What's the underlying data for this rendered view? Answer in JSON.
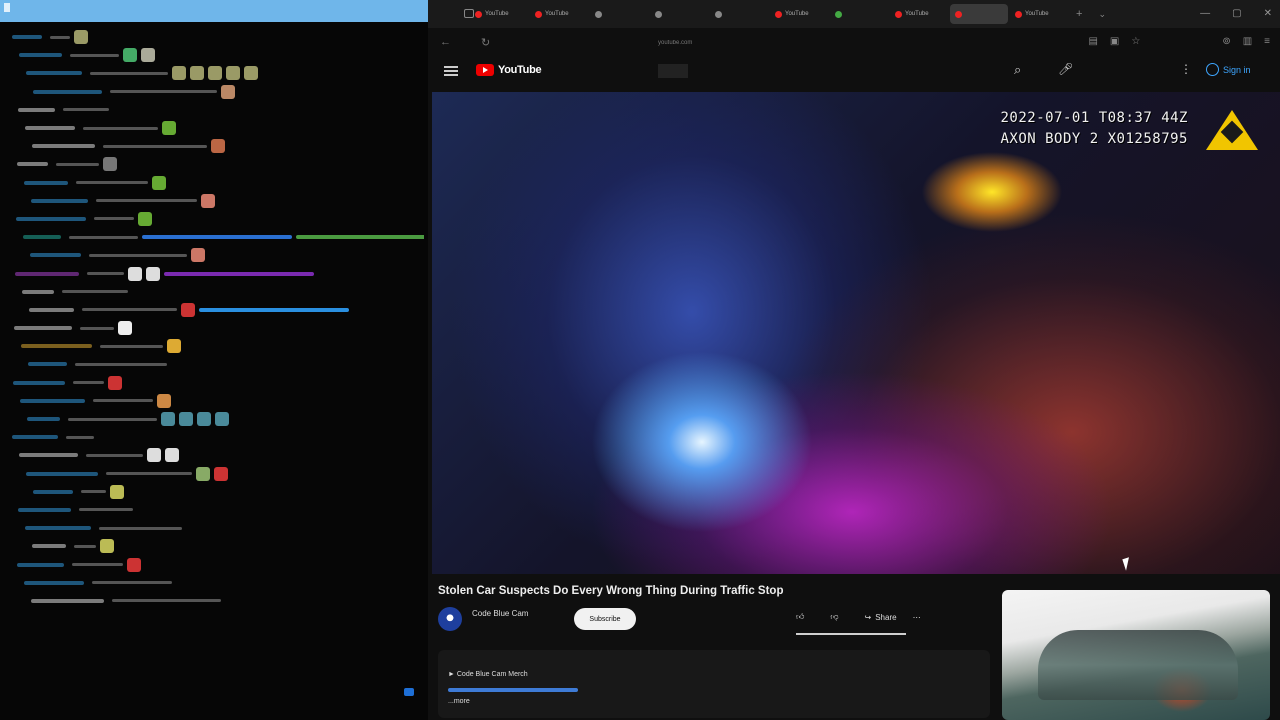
{
  "chat": {
    "rows": [
      {
        "user": "",
        "msg": "",
        "uc": "#39d",
        "emotes": [
          "#9a9a66"
        ],
        "bars": []
      },
      {
        "user": "",
        "msg": "",
        "uc": "#39d",
        "emotes": [
          "#4a6",
          "#aa9"
        ],
        "bars": []
      },
      {
        "user": "",
        "msg": "",
        "uc": "#39d",
        "emotes": [
          "#9a9a66",
          "#9a9a66",
          "#9a9a66",
          "#9a9a66",
          "#9a9a66"
        ],
        "bars": []
      },
      {
        "user": "",
        "msg": "",
        "uc": "#39d",
        "emotes": [
          "#b86"
        ],
        "bars": []
      },
      {
        "user": "",
        "msg": "",
        "uc": "#ddd",
        "emotes": [],
        "bars": []
      },
      {
        "user": "",
        "msg": "",
        "uc": "#ddd",
        "emotes": [
          "#6a3"
        ],
        "bars": []
      },
      {
        "user": "",
        "msg": "",
        "uc": "#ddd",
        "emotes": [
          "#b64"
        ],
        "bars": []
      },
      {
        "user": "",
        "msg": "",
        "uc": "#ddd",
        "emotes": [
          "#777"
        ],
        "bars": []
      },
      {
        "user": "",
        "msg": "",
        "uc": "#39d",
        "emotes": [
          "#6a3"
        ],
        "bars": []
      },
      {
        "user": "",
        "msg": "",
        "uc": "#39d",
        "emotes": [
          "#c76"
        ],
        "bars": []
      },
      {
        "user": "",
        "msg": "",
        "uc": "#39d",
        "emotes": [
          "#6a3"
        ],
        "bars": []
      },
      {
        "user": "",
        "msg": "",
        "uc": "#2a9",
        "emotes": [],
        "bars": [
          "#2a6fd0",
          "#4a9a40"
        ]
      },
      {
        "user": "",
        "msg": "",
        "uc": "#39d",
        "emotes": [
          "#c76"
        ],
        "bars": []
      },
      {
        "user": "",
        "msg": "",
        "uc": "#a4c",
        "emotes": [
          "#ddd",
          "#ddd"
        ],
        "bars": [
          "#7a2ab0"
        ]
      },
      {
        "user": "",
        "msg": "",
        "uc": "#ddd",
        "emotes": [],
        "bars": []
      },
      {
        "user": "",
        "msg": "",
        "uc": "#ddd",
        "emotes": [
          "#c33"
        ],
        "bars": [
          "#2a8fe0"
        ]
      },
      {
        "user": "",
        "msg": "",
        "uc": "#ddd",
        "emotes": [
          "#eee"
        ],
        "bars": []
      },
      {
        "user": "",
        "msg": "",
        "uc": "#da3",
        "emotes": [
          "#da3"
        ],
        "bars": []
      },
      {
        "user": "",
        "msg": "",
        "uc": "#39d",
        "emotes": [],
        "bars": []
      },
      {
        "user": "",
        "msg": "",
        "uc": "#39d",
        "emotes": [
          "#c33"
        ],
        "bars": []
      },
      {
        "user": "",
        "msg": "",
        "uc": "#39d",
        "emotes": [
          "#c84"
        ],
        "bars": []
      },
      {
        "user": "",
        "msg": "",
        "uc": "#39d",
        "emotes": [
          "#4a8a9a",
          "#4a8a9a",
          "#4a8a9a",
          "#4a8a9a"
        ],
        "bars": []
      },
      {
        "user": "",
        "msg": "",
        "uc": "#39d",
        "emotes": [],
        "bars": []
      },
      {
        "user": "",
        "msg": "",
        "uc": "#ddd",
        "emotes": [
          "#ddd",
          "#ddd"
        ],
        "bars": []
      },
      {
        "user": "",
        "msg": "",
        "uc": "#39d",
        "emotes": [
          "#8a6",
          "#c33"
        ],
        "bars": []
      },
      {
        "user": "",
        "msg": "",
        "uc": "#39d",
        "emotes": [
          "#bb5"
        ],
        "bars": []
      },
      {
        "user": "",
        "msg": "",
        "uc": "#39d",
        "emotes": [],
        "bars": []
      },
      {
        "user": "",
        "msg": "",
        "uc": "#39d",
        "emotes": [],
        "bars": []
      },
      {
        "user": "",
        "msg": "",
        "uc": "#ddd",
        "emotes": [
          "#bb5"
        ],
        "bars": []
      },
      {
        "user": "",
        "msg": "",
        "uc": "#39d",
        "emotes": [
          "#c33"
        ],
        "bars": []
      },
      {
        "user": "",
        "msg": "",
        "uc": "#39d",
        "emotes": [],
        "bars": []
      },
      {
        "user": "",
        "msg": "",
        "uc": "#ddd",
        "emotes": [],
        "bars": []
      }
    ]
  },
  "browser": {
    "tabs": [
      {
        "label": "YouTube",
        "color": "#e22",
        "active": false
      },
      {
        "label": "YouTube",
        "color": "#e22",
        "active": false
      },
      {
        "label": "",
        "color": "#888",
        "active": false
      },
      {
        "label": "",
        "color": "#888",
        "active": false
      },
      {
        "label": "",
        "color": "#888",
        "active": false
      },
      {
        "label": "YouTube",
        "color": "#e22",
        "active": false
      },
      {
        "label": "",
        "color": "#4a4",
        "active": false
      },
      {
        "label": "YouTube",
        "color": "#e22",
        "active": false
      },
      {
        "label": "",
        "color": "#e22",
        "active": true
      },
      {
        "label": "YouTube",
        "color": "#e22",
        "active": false
      }
    ],
    "new_tab": "+",
    "window_controls": [
      "—",
      "▢",
      "✕"
    ],
    "address": {
      "url": "youtube.com"
    }
  },
  "youtube": {
    "logo_text": "YouTube",
    "search_placeholder": "",
    "signin_label": "Sign in",
    "more_icon": "⋮"
  },
  "video": {
    "stamp_line1": "2022-07-01 T08:37 44Z",
    "stamp_line2": "AXON BODY 2 X01258795",
    "title": "Stolen Car Suspects Do Every Wrong Thing During Traffic Stop",
    "channel": "Code Blue Cam",
    "subscribers": "",
    "subscribe_label": "Subscribe",
    "likes": "",
    "dislikes": "",
    "share_label": "Share",
    "more_label": "⋯",
    "description": {
      "line1": "",
      "line2": "Code Blue Cam Merch",
      "more_label": "...more"
    }
  },
  "colors": {
    "chat_top": "#6fb6ea",
    "yt_red": "#e00",
    "link_blue": "#3ea6ff",
    "axon_yellow": "#f1c500"
  }
}
